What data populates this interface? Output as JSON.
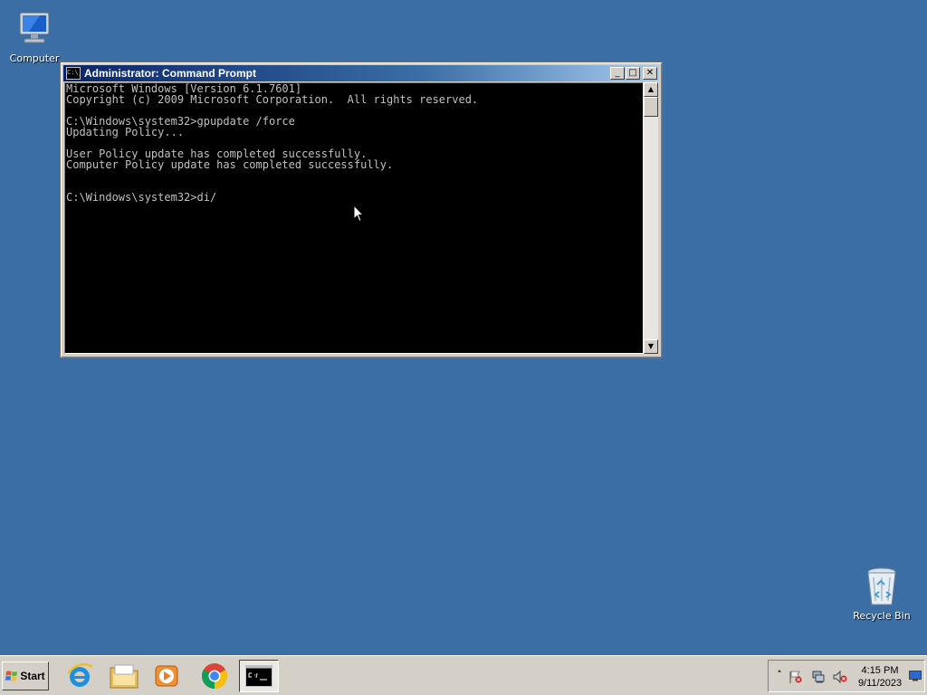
{
  "desktop": {
    "icons": [
      {
        "label": "Computer"
      },
      {
        "label": "Recycle Bin"
      }
    ]
  },
  "window": {
    "title": "Administrator: Command Prompt",
    "icon_glyph": "C:\\_",
    "buttons": {
      "minimize": "_",
      "maximize": "□",
      "close": "✕"
    },
    "console_lines": [
      "Microsoft Windows [Version 6.1.7601]",
      "Copyright (c) 2009 Microsoft Corporation.  All rights reserved.",
      "",
      "C:\\Windows\\system32>gpupdate /force",
      "Updating Policy...",
      "",
      "User Policy update has completed successfully.",
      "Computer Policy update has completed successfully.",
      "",
      "",
      "C:\\Windows\\system32>di/"
    ],
    "scroll": {
      "up": "▲",
      "down": "▼"
    }
  },
  "taskbar": {
    "start_label": "Start",
    "apps": [
      {
        "icon": "internet-explorer-icon"
      },
      {
        "icon": "windows-explorer-icon"
      },
      {
        "icon": "media-player-icon"
      },
      {
        "icon": "chrome-icon"
      },
      {
        "icon": "command-prompt-icon",
        "active": true
      }
    ],
    "tray": {
      "chevron": "˄",
      "time": "4:15 PM",
      "date": "9/11/2023"
    }
  },
  "colors": {
    "desktop": "#3a6ea5",
    "console_bg": "#000000",
    "console_fg": "#c0c0c0",
    "titlebar_start": "#0a246a",
    "titlebar_end": "#a6caf0",
    "chrome": "#d4d0c8"
  }
}
